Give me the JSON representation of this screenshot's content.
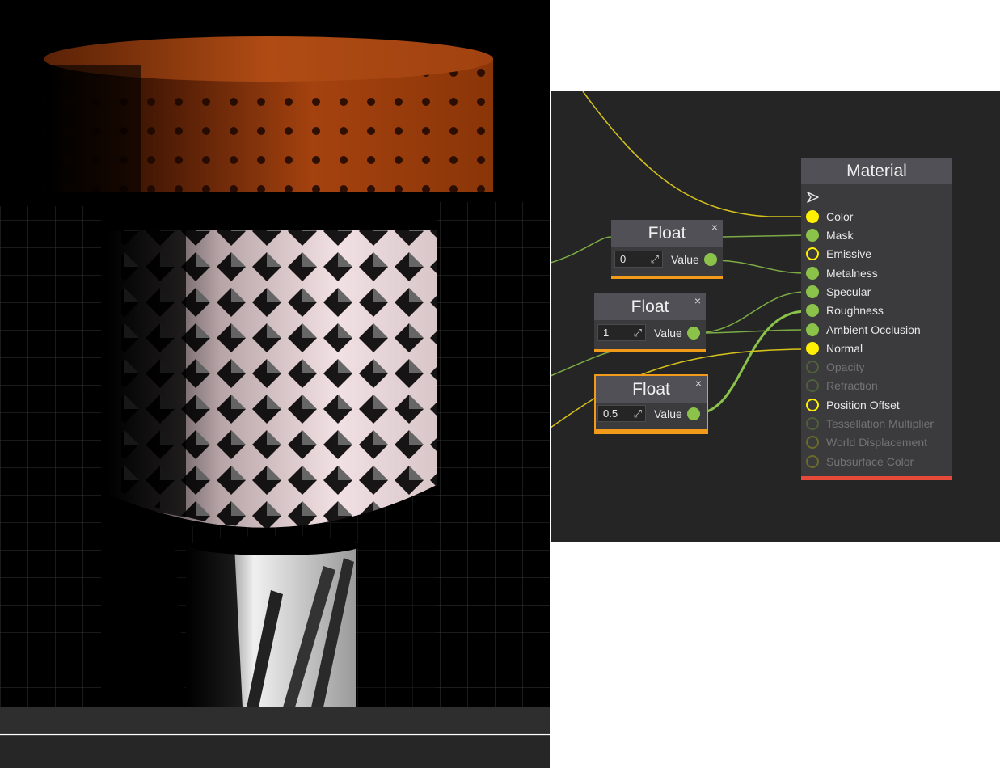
{
  "graph": {
    "material_node": {
      "title": "Material",
      "inputs": [
        {
          "label": "Color",
          "pin": "yellow-filled"
        },
        {
          "label": "Mask",
          "pin": "green-filled"
        },
        {
          "label": "Emissive",
          "pin": "yellow-ring"
        },
        {
          "label": "Metalness",
          "pin": "green-filled"
        },
        {
          "label": "Specular",
          "pin": "green-filled"
        },
        {
          "label": "Roughness",
          "pin": "green-filled"
        },
        {
          "label": "Ambient Occlusion",
          "pin": "green-filled"
        },
        {
          "label": "Normal",
          "pin": "yellow-filled"
        },
        {
          "label": "Opacity",
          "pin": "disabled"
        },
        {
          "label": "Refraction",
          "pin": "disabled"
        },
        {
          "label": "Position Offset",
          "pin": "yellow-ring"
        },
        {
          "label": "Tessellation Multiplier",
          "pin": "disabled"
        },
        {
          "label": "World Displacement",
          "pin": "disabled"
        },
        {
          "label": "Subsurface Color",
          "pin": "disabled"
        }
      ]
    },
    "float_nodes": [
      {
        "title": "Float",
        "value": "0",
        "output_label": "Value",
        "close": "×",
        "selected": false
      },
      {
        "title": "Float",
        "value": "1",
        "output_label": "Value",
        "close": "×",
        "selected": false
      },
      {
        "title": "Float",
        "value": "0.5",
        "output_label": "Value",
        "close": "×",
        "selected": true
      }
    ]
  },
  "colors": {
    "float_pin": "#8bc34a",
    "color_pin": "#ffef00",
    "node_header": "#505056",
    "float_footer": "#f29a1a",
    "material_footer": "#e84a3a",
    "graph_background": "#252526"
  },
  "icons": {
    "material_output": "play-arrow-outline-icon",
    "float_close": "close-icon",
    "value_field": "expand-icon"
  }
}
